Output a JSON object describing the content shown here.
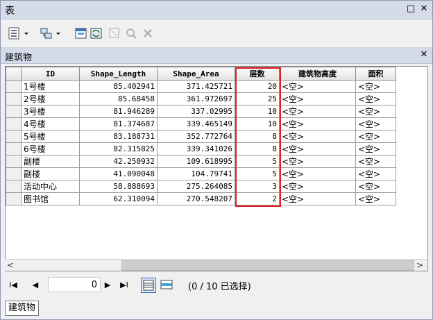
{
  "window": {
    "title": "表",
    "restore_glyph": "□",
    "close_glyph": "✕"
  },
  "table_tab": {
    "title": "建筑物",
    "close_glyph": "✕"
  },
  "toolbar": {
    "icons": [
      "table-options-icon",
      "related-tables-icon",
      "select-by-attributes-icon",
      "switch-selection-icon",
      "clear-selection-icon",
      "zoom-to-selected-icon",
      "delete-selected-icon"
    ]
  },
  "columns": [
    {
      "name": "ID"
    },
    {
      "name": "Shape_Length"
    },
    {
      "name": "Shape_Area"
    },
    {
      "name": "层数"
    },
    {
      "name": "建筑物高度"
    },
    {
      "name": "面积"
    }
  ],
  "rows": [
    [
      "1号楼",
      "85.402941",
      "371.425721",
      "20",
      "<空>",
      "<空>"
    ],
    [
      "2号楼",
      "85.68458",
      "361.972697",
      "25",
      "<空>",
      "<空>"
    ],
    [
      "3号楼",
      "81.946289",
      "337.02995",
      "10",
      "<空>",
      "<空>"
    ],
    [
      "4号楼",
      "81.374687",
      "339.465149",
      "10",
      "<空>",
      "<空>"
    ],
    [
      "5号楼",
      "83.188731",
      "352.772764",
      "8",
      "<空>",
      "<空>"
    ],
    [
      "6号楼",
      "82.315825",
      "339.341026",
      "8",
      "<空>",
      "<空>"
    ],
    [
      "副楼",
      "42.250932",
      "109.618995",
      "5",
      "<空>",
      "<空>"
    ],
    [
      "副楼",
      "41.090048",
      "104.79741",
      "5",
      "<空>",
      "<空>"
    ],
    [
      "活动中心",
      "58.888693",
      "275.264085",
      "3",
      "<空>",
      "<空>"
    ],
    [
      "图书馆",
      "62.310094",
      "270.548207",
      "2",
      "<空>",
      "<空>"
    ]
  ],
  "highlight_color": "#e02020",
  "nav": {
    "first": "I◀",
    "prev": "◀",
    "record": "0",
    "next": "▶",
    "last": "▶I"
  },
  "status": "(0 / 10 已选择)",
  "bottom_tab": "建筑物"
}
